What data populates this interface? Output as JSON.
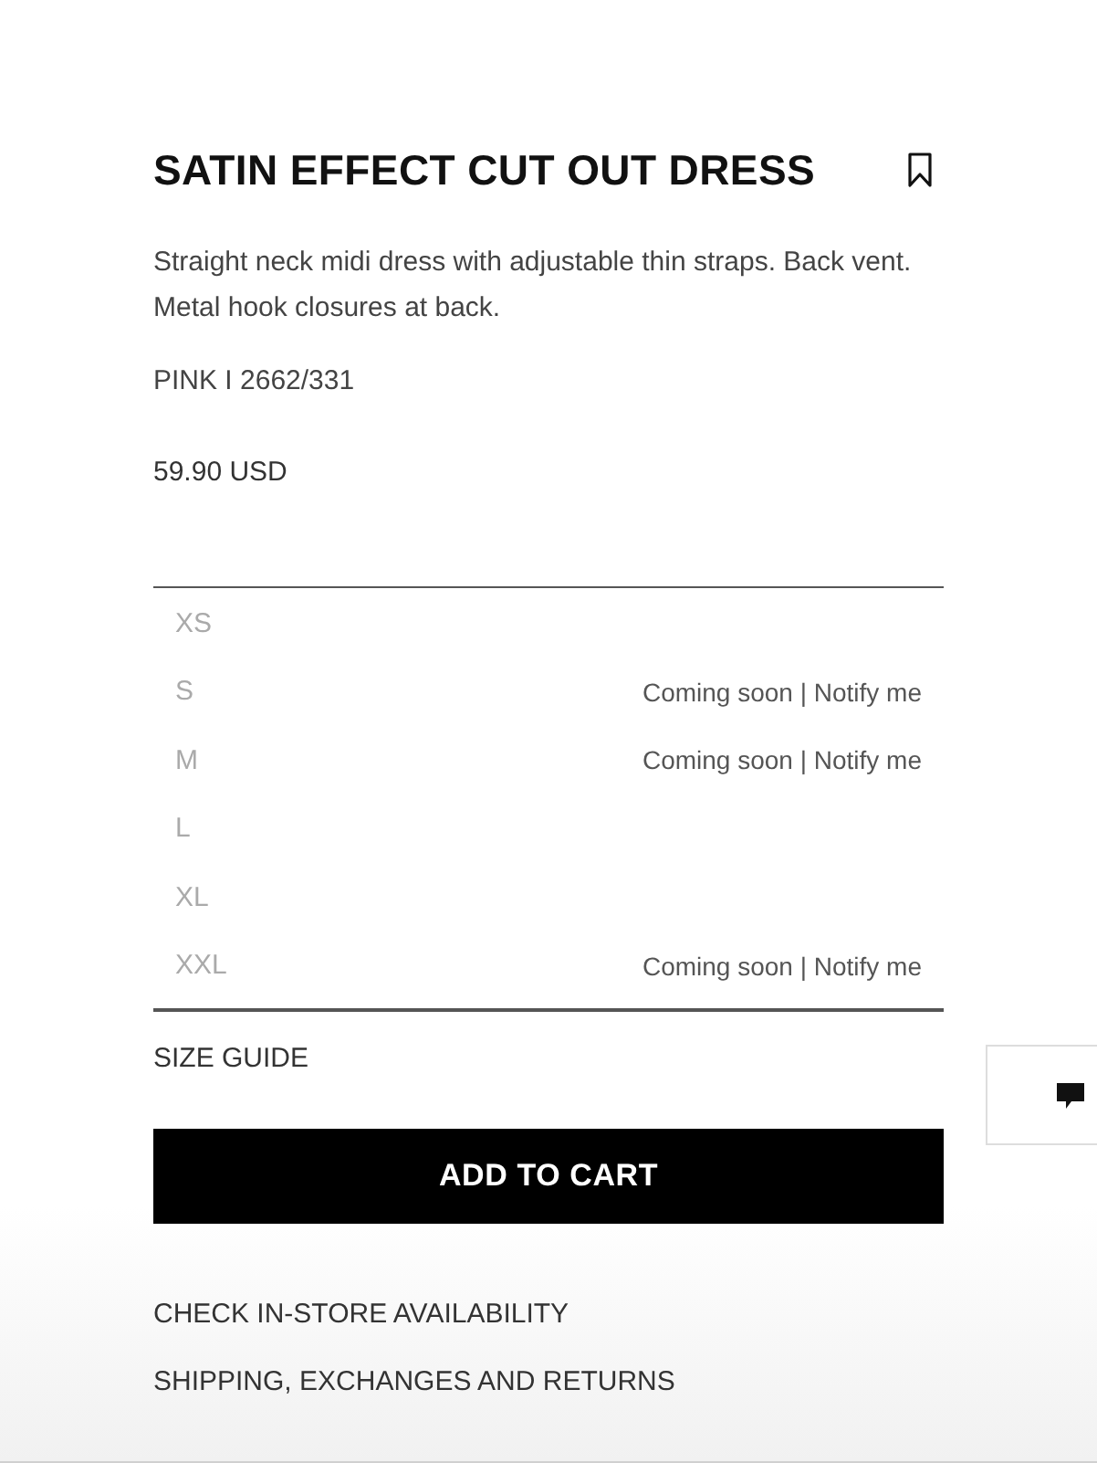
{
  "product": {
    "title": "SATIN EFFECT CUT OUT DRESS",
    "description": "Straight neck midi dress with adjustable thin straps. Back vent. Metal hook closures at back.",
    "color_reference": "PINK I 2662/331",
    "price": "59.90 USD"
  },
  "sizes": [
    {
      "label": "XS"
    },
    {
      "label": "S",
      "status": "Coming soon | Notify me"
    },
    {
      "label": "M",
      "status": "Coming soon | Notify me"
    },
    {
      "label": "L"
    },
    {
      "label": "XL"
    },
    {
      "label": "XXL",
      "status": "Coming soon | Notify me"
    }
  ],
  "size_guide": "SIZE GUIDE",
  "add_to_cart": "ADD TO CART",
  "links": [
    "CHECK IN-STORE AVAILABILITY",
    "SHIPPING, EXCHANGES AND RETURNS"
  ]
}
